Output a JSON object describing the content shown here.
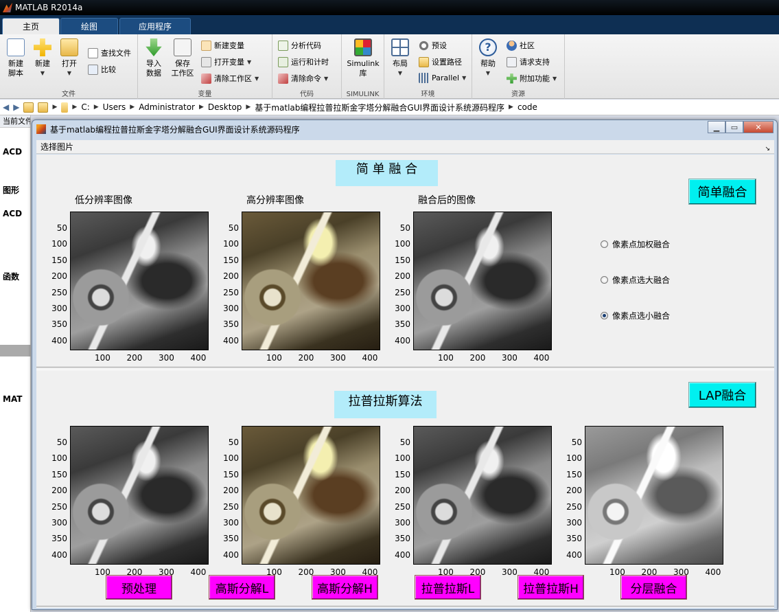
{
  "app": {
    "title": "MATLAB R2014a"
  },
  "ribbon_tabs": [
    {
      "label": "主页",
      "active": true
    },
    {
      "label": "绘图",
      "active": false
    },
    {
      "label": "应用程序",
      "active": false
    }
  ],
  "ribbon": {
    "file": {
      "name": "文件",
      "new_script_l1": "新建",
      "new_script_l2": "脚本",
      "new": "新建",
      "open": "打开",
      "find_files": "查找文件",
      "compare": "比较"
    },
    "variable": {
      "name": "变量",
      "import_l1": "导入",
      "import_l2": "数据",
      "save_l1": "保存",
      "save_l2": "工作区",
      "new_var": "新建变量",
      "open_var": "打开变量",
      "clear_ws": "清除工作区"
    },
    "code": {
      "name": "代码",
      "analyze": "分析代码",
      "run_time": "运行和计时",
      "clear_cmd": "清除命令"
    },
    "simulink": {
      "name": "SIMULINK",
      "label_l1": "Simulink",
      "label_l2": "库"
    },
    "env": {
      "name": "环境",
      "layout": "布局",
      "prefs": "预设",
      "set_path": "设置路径",
      "parallel": "Parallel"
    },
    "resources": {
      "name": "资源",
      "help": "帮助",
      "community": "社区",
      "support": "请求支持",
      "addons": "附加功能"
    }
  },
  "address": {
    "path": [
      "C:",
      "Users",
      "Administrator",
      "Desktop",
      "基于matlab编程拉普拉斯金字塔分解融合GUI界面设计系统源码程序",
      "code"
    ]
  },
  "left_panel": {
    "header": "当前文件夹",
    "items": [
      "ACD",
      "图形",
      "ACD",
      "函数",
      "MAT"
    ]
  },
  "figure": {
    "title": "基于matlab编程拉普拉斯金字塔分解融合GUI界面设计系统源码程序",
    "menu": "选择图片",
    "top": {
      "heading": "简  单  融  合",
      "button": "简单融合",
      "axes_titles": [
        "低分辨率图像",
        "高分辨率图像",
        "融合后的图像"
      ],
      "radios": [
        {
          "label": "像素点加权融合",
          "selected": false
        },
        {
          "label": "像素点选大融合",
          "selected": false
        },
        {
          "label": "像素点选小融合",
          "selected": true
        }
      ]
    },
    "bottom": {
      "heading": "拉普拉斯算法",
      "button": "LAP融合",
      "buttons": [
        "预处理",
        "高斯分解L",
        "高斯分解H",
        "拉普拉斯L",
        "拉普拉斯H",
        "分层融合"
      ]
    },
    "yticks": [
      "50",
      "100",
      "150",
      "200",
      "250",
      "300",
      "350",
      "400"
    ],
    "xticks": [
      "100",
      "200",
      "300",
      "400"
    ],
    "colors": {
      "cyan": "#00f0f0",
      "magenta": "#ff00ff",
      "heading_bg": "#b3ecfa"
    }
  }
}
